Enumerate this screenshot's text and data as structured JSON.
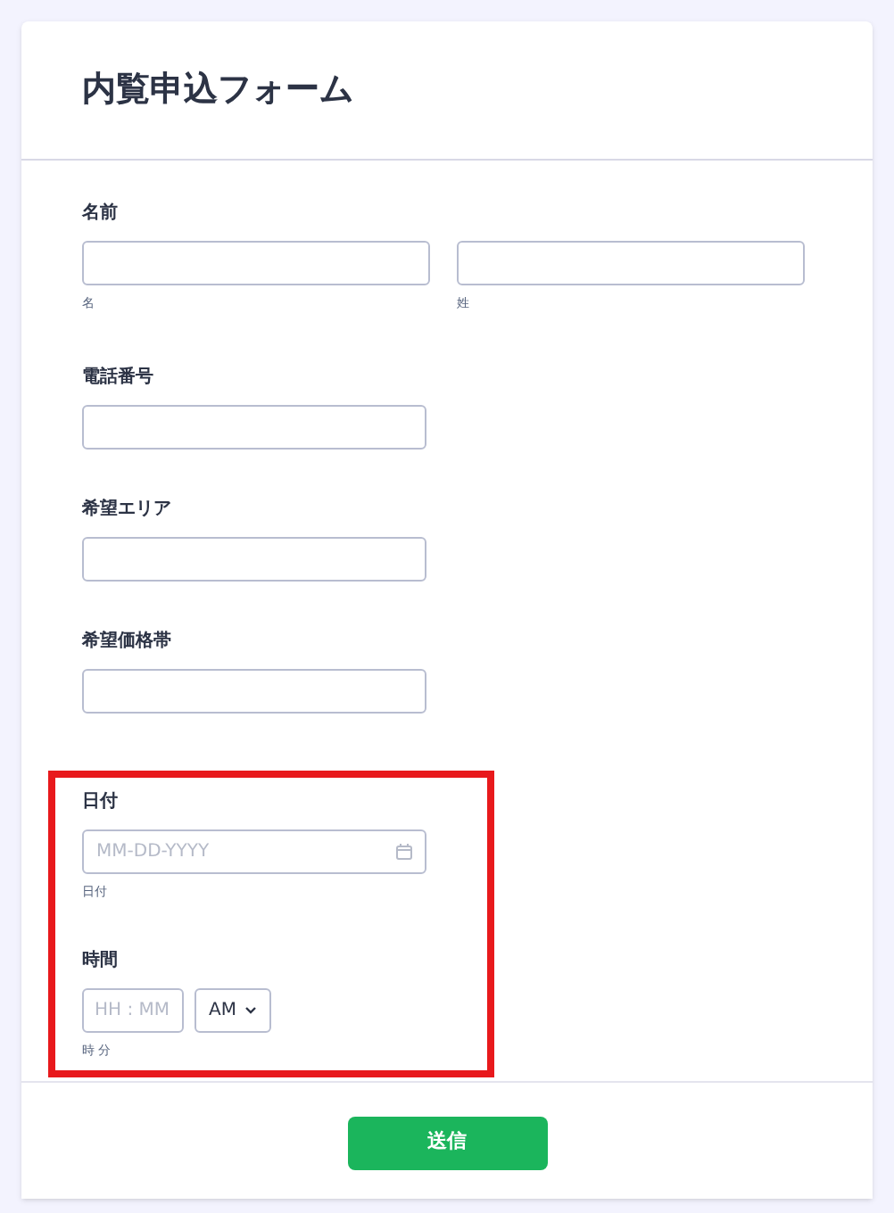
{
  "title": "内覧申込フォーム",
  "sections": [
    {
      "highlighted": false,
      "fields": [
        {
          "kind": "name",
          "label": "名前",
          "parts": [
            {
              "sublabel": "名"
            },
            {
              "sublabel": "姓"
            }
          ]
        },
        {
          "kind": "text",
          "label": "電話番号"
        },
        {
          "kind": "text",
          "label": "希望エリア"
        },
        {
          "kind": "text",
          "label": "希望価格帯"
        }
      ]
    },
    {
      "highlighted": true,
      "fields": [
        {
          "kind": "date",
          "label": "日付",
          "placeholder": "MM-DD-YYYY",
          "sublabel": "日付"
        },
        {
          "kind": "time",
          "label": "時間",
          "placeholder": "HH : MM",
          "period": "AM",
          "sublabel": "時 分"
        }
      ]
    }
  ],
  "submit": "送信"
}
